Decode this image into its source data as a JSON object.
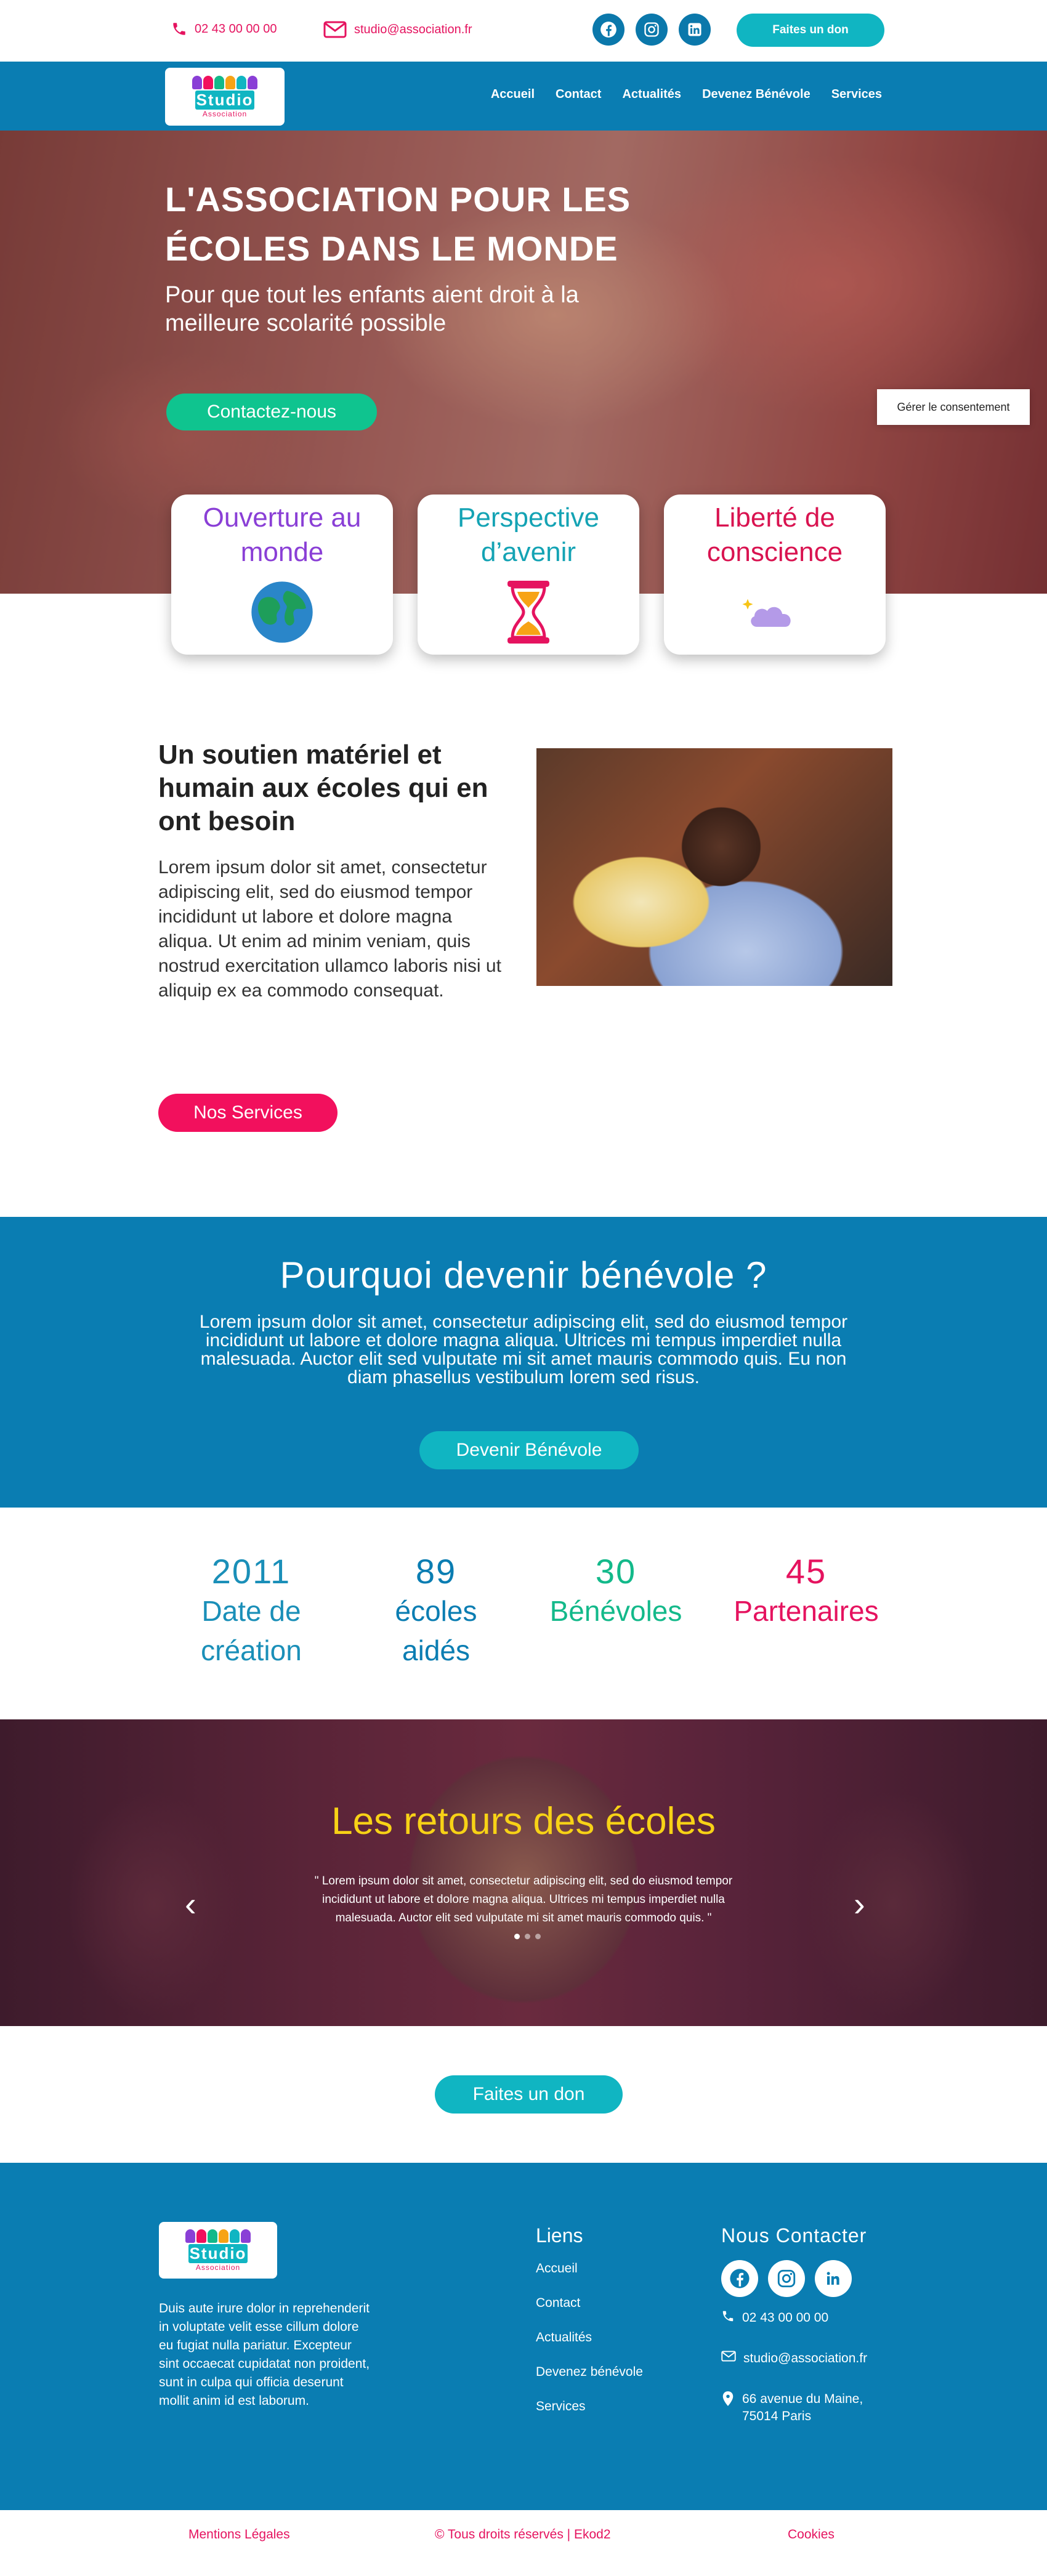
{
  "topbar": {
    "phone": "02 43 00 00 00",
    "email": "studio@association.fr",
    "socials": [
      "facebook-icon",
      "instagram-icon",
      "linkedin-icon"
    ],
    "donate": "Faites un don"
  },
  "logo": {
    "word": "Studio",
    "sub": "Association"
  },
  "nav": {
    "items": [
      "Accueil",
      "Contact",
      "Actualités",
      "Devenez Bénévole",
      "Services"
    ]
  },
  "hero": {
    "title_line1": "L'ASSOCIATION POUR LES",
    "title_line2": "ÉCOLES DANS LE MONDE",
    "subtitle": "Pour que tout les enfants aient droit à la meilleure scolarité possible",
    "cta": "Contactez-nous"
  },
  "values": [
    {
      "title": "Ouverture au monde",
      "color": "#8a3fd6",
      "icon": "globe-icon"
    },
    {
      "title": "Perspective d’avenir",
      "color": "#14a3b4",
      "icon": "hourglass-icon"
    },
    {
      "title": "Liberté de conscience",
      "color": "#d91350",
      "icon": "cloud-icon"
    }
  ],
  "consent": "Gérer le consentement",
  "about": {
    "title": "Un soutien matériel et humain aux écoles qui en ont besoin",
    "text": "Lorem ipsum dolor sit amet, consectetur adipiscing elit, sed do eiusmod tempor incididunt ut labore et dolore magna aliqua. Ut enim ad minim veniam, quis nostrud exercitation ullamco laboris nisi ut aliquip ex ea commodo consequat.",
    "cta": "Nos Services"
  },
  "volunteer": {
    "title": "Pourquoi devenir bénévole ?",
    "text": "Lorem ipsum dolor sit amet, consectetur adipiscing elit, sed do eiusmod tempor incididunt ut labore et dolore magna aliqua. Ultrices mi tempus imperdiet nulla malesuada. Auctor elit sed vulputate mi sit amet mauris commodo quis. Eu non diam phasellus vestibulum lorem sed risus.",
    "cta": "Devenir Bénévole"
  },
  "stats": [
    {
      "num": "2011",
      "label": "Date de création",
      "color": "#1a8fb8"
    },
    {
      "num": "89",
      "label": "écoles aidés",
      "color": "#0a7db2"
    },
    {
      "num": "30",
      "label": "Bénévoles",
      "color": "#13b98a"
    },
    {
      "num": "45",
      "label": "Partenaires",
      "color": "#e5135f"
    }
  ],
  "testimonials": {
    "title": "Les retours des écoles",
    "quote": "\" Lorem ipsum dolor sit amet, consectetur adipiscing elit, sed do eiusmod tempor incididunt ut labore et dolore magna aliqua. Ultrices mi tempus imperdiet nulla malesuada. Auctor elit sed vulputate mi sit amet mauris commodo quis. \"",
    "prev": "‹",
    "next": "›"
  },
  "donate_band": {
    "cta": "Faites un don"
  },
  "footer": {
    "text": "Duis aute irure dolor in reprehenderit in voluptate velit esse cillum dolore eu fugiat nulla pariatur. Excepteur sint occaecat cupidatat non proident, sunt in culpa qui officia deserunt mollit anim id est laborum.",
    "links_title": "Liens",
    "links": [
      "Accueil",
      "Contact",
      "Actualités",
      "Devenez bénévole",
      "Services"
    ],
    "contact_title": "Nous Contacter",
    "phone": "02 43 00 00 00",
    "email": "studio@association.fr",
    "address_line1": "66 avenue du Maine,",
    "address_line2": "75014 Paris"
  },
  "bottom": {
    "legal": "Mentions Légales",
    "copyright": "© Tous droits réservés | Ekod2",
    "cookies": "Cookies"
  },
  "colors": {
    "brand_blue": "#0a7db2",
    "pink": "#e5135f",
    "teal": "#10b5c2",
    "green": "#0fc48f",
    "yellow": "#f7d216"
  }
}
